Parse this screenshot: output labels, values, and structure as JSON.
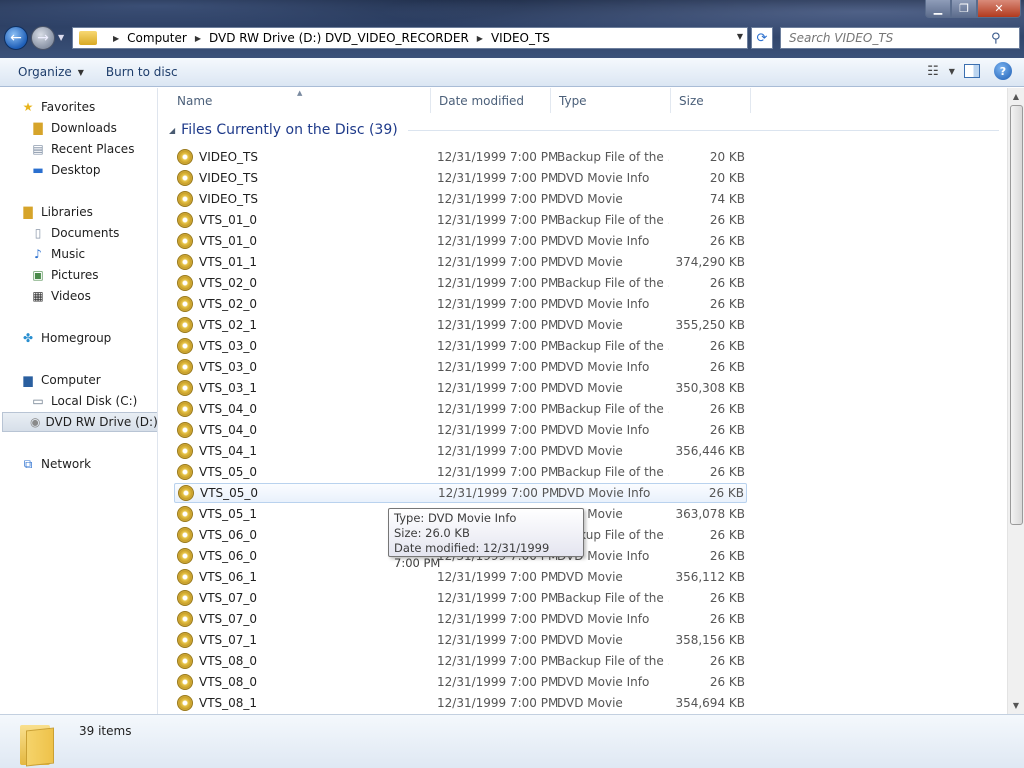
{
  "window": {
    "minimize": "▁",
    "maximize": "❐",
    "close": "✕"
  },
  "address": {
    "crumbs": [
      "Computer",
      "DVD RW Drive (D:) DVD_VIDEO_RECORDER",
      "VIDEO_TS"
    ]
  },
  "search": {
    "placeholder": "Search VIDEO_TS"
  },
  "toolbar": {
    "organize": "Organize",
    "burn": "Burn to disc"
  },
  "nav": {
    "favorites": "Favorites",
    "downloads": "Downloads",
    "recent": "Recent Places",
    "desktop": "Desktop",
    "libraries": "Libraries",
    "documents": "Documents",
    "music": "Music",
    "pictures": "Pictures",
    "videos": "Videos",
    "homegroup": "Homegroup",
    "computer": "Computer",
    "localdisk": "Local Disk (C:)",
    "dvd": "DVD RW Drive (D:) D",
    "network": "Network"
  },
  "columns": {
    "name": "Name",
    "date": "Date modified",
    "type": "Type",
    "size": "Size"
  },
  "group": {
    "title": "Files Currently on the Disc (39)"
  },
  "files": [
    {
      "name": "VIDEO_TS",
      "date": "12/31/1999 7:00 PM",
      "type": "Backup File of the ...",
      "size": "20 KB"
    },
    {
      "name": "VIDEO_TS",
      "date": "12/31/1999 7:00 PM",
      "type": "DVD Movie Info",
      "size": "20 KB"
    },
    {
      "name": "VIDEO_TS",
      "date": "12/31/1999 7:00 PM",
      "type": "DVD Movie",
      "size": "74 KB"
    },
    {
      "name": "VTS_01_0",
      "date": "12/31/1999 7:00 PM",
      "type": "Backup File of the ...",
      "size": "26 KB"
    },
    {
      "name": "VTS_01_0",
      "date": "12/31/1999 7:00 PM",
      "type": "DVD Movie Info",
      "size": "26 KB"
    },
    {
      "name": "VTS_01_1",
      "date": "12/31/1999 7:00 PM",
      "type": "DVD Movie",
      "size": "374,290 KB"
    },
    {
      "name": "VTS_02_0",
      "date": "12/31/1999 7:00 PM",
      "type": "Backup File of the ...",
      "size": "26 KB"
    },
    {
      "name": "VTS_02_0",
      "date": "12/31/1999 7:00 PM",
      "type": "DVD Movie Info",
      "size": "26 KB"
    },
    {
      "name": "VTS_02_1",
      "date": "12/31/1999 7:00 PM",
      "type": "DVD Movie",
      "size": "355,250 KB"
    },
    {
      "name": "VTS_03_0",
      "date": "12/31/1999 7:00 PM",
      "type": "Backup File of the ...",
      "size": "26 KB"
    },
    {
      "name": "VTS_03_0",
      "date": "12/31/1999 7:00 PM",
      "type": "DVD Movie Info",
      "size": "26 KB"
    },
    {
      "name": "VTS_03_1",
      "date": "12/31/1999 7:00 PM",
      "type": "DVD Movie",
      "size": "350,308 KB"
    },
    {
      "name": "VTS_04_0",
      "date": "12/31/1999 7:00 PM",
      "type": "Backup File of the ...",
      "size": "26 KB"
    },
    {
      "name": "VTS_04_0",
      "date": "12/31/1999 7:00 PM",
      "type": "DVD Movie Info",
      "size": "26 KB"
    },
    {
      "name": "VTS_04_1",
      "date": "12/31/1999 7:00 PM",
      "type": "DVD Movie",
      "size": "356,446 KB"
    },
    {
      "name": "VTS_05_0",
      "date": "12/31/1999 7:00 PM",
      "type": "Backup File of the ...",
      "size": "26 KB"
    },
    {
      "name": "VTS_05_0",
      "date": "12/31/1999 7:00 PM",
      "type": "DVD Movie Info",
      "size": "26 KB"
    },
    {
      "name": "VTS_05_1",
      "date": "12/31/1999 7:00 PM",
      "type": "DVD Movie",
      "size": "363,078 KB"
    },
    {
      "name": "VTS_06_0",
      "date": "12/31/1999 7:00 PM",
      "type": "Backup File of the ...",
      "size": "26 KB"
    },
    {
      "name": "VTS_06_0",
      "date": "12/31/1999 7:00 PM",
      "type": "DVD Movie Info",
      "size": "26 KB"
    },
    {
      "name": "VTS_06_1",
      "date": "12/31/1999 7:00 PM",
      "type": "DVD Movie",
      "size": "356,112 KB"
    },
    {
      "name": "VTS_07_0",
      "date": "12/31/1999 7:00 PM",
      "type": "Backup File of the ...",
      "size": "26 KB"
    },
    {
      "name": "VTS_07_0",
      "date": "12/31/1999 7:00 PM",
      "type": "DVD Movie Info",
      "size": "26 KB"
    },
    {
      "name": "VTS_07_1",
      "date": "12/31/1999 7:00 PM",
      "type": "DVD Movie",
      "size": "358,156 KB"
    },
    {
      "name": "VTS_08_0",
      "date": "12/31/1999 7:00 PM",
      "type": "Backup File of the ...",
      "size": "26 KB"
    },
    {
      "name": "VTS_08_0",
      "date": "12/31/1999 7:00 PM",
      "type": "DVD Movie Info",
      "size": "26 KB"
    },
    {
      "name": "VTS_08_1",
      "date": "12/31/1999 7:00 PM",
      "type": "DVD Movie",
      "size": "354,694 KB"
    }
  ],
  "hover_index": 16,
  "tooltip": {
    "line1": "Type: DVD Movie Info",
    "line2": "Size: 26.0 KB",
    "line3": "Date modified: 12/31/1999 7:00 PM"
  },
  "status": {
    "count": "39 items"
  },
  "icons": {
    "back": "back-arrow-icon",
    "forward": "forward-arrow-icon",
    "refresh": "refresh-icon",
    "search": "search-icon",
    "views": "view-options-icon",
    "preview": "preview-pane-icon",
    "help": "help-icon",
    "disc_file": "dvd-file-icon"
  },
  "colors": {
    "accent": "#1e3a8a",
    "title_bar": "#2c3f63",
    "hover": "#e9f1fc"
  }
}
